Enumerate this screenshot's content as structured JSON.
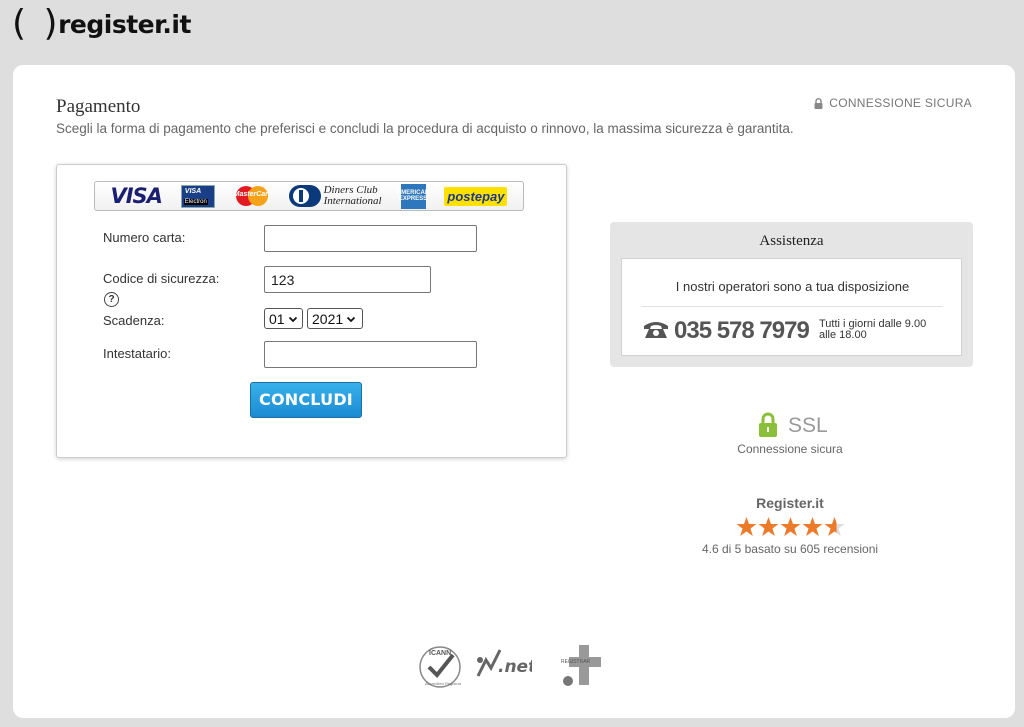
{
  "brand": {
    "name": "register.it"
  },
  "page": {
    "title": "Pagamento",
    "subtitle": "Scegli la forma di pagamento che preferisci e concludi la procedura di acquisto o rinnovo, la massima sicurezza è garantita.",
    "secure_label": "CONNESSIONE SICURA"
  },
  "payment_methods": {
    "visa": "VISA",
    "visa_electron_top": "VISA",
    "visa_electron_bottom": "Electron",
    "mastercard": "MasterCard",
    "diners_line1": "Diners Club",
    "diners_line2": "International",
    "amex": "AMERICAN EXPRESS",
    "postepay": "postepay"
  },
  "form": {
    "card_number_label": "Numero carta:",
    "card_number_value": "",
    "security_code_label": "Codice di sicurezza:",
    "security_code_value": "123",
    "help_symbol": "?",
    "expiry_label": "Scadenza:",
    "expiry_month": "01",
    "expiry_year": "2021",
    "holder_label": "Intestatario:",
    "holder_value": "",
    "submit_label": "CONCLUDI"
  },
  "assistance": {
    "title": "Assistenza",
    "message": "I nostri operatori sono a tua disposizione",
    "phone": "035 578 7979",
    "hours": "Tutti i giorni dalle 9.00 alle 18.00"
  },
  "ssl": {
    "label": "SSL",
    "caption": "Connessione sicura"
  },
  "rating": {
    "title": "Register.it",
    "stars": 4.6,
    "max_stars": 5,
    "caption": "4.6 di 5 basato su 605 recensioni"
  },
  "footer_logos": {
    "icann": "ICANN",
    "icann_sub": "Accredited Registrar",
    "net": ".net",
    "registrar": "REGISTRAR"
  },
  "colors": {
    "accent_button": "#1b8ad3",
    "star": "#ec7a2b",
    "ssl_lock": "#8bbf3a"
  }
}
